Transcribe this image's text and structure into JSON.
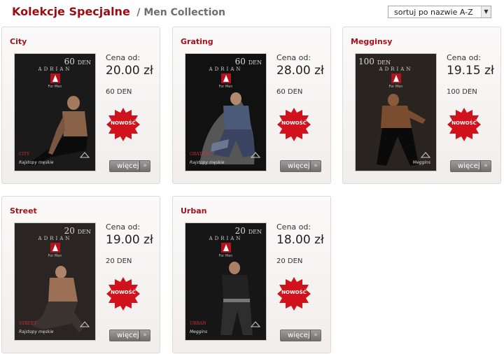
{
  "header": {
    "title": "Kolekcje Specjalne",
    "subtitle": "/ Men Collection",
    "sort_value": "sortuj po nazwie A-Z"
  },
  "colors": {
    "accent": "#a80f19",
    "badge": "#d0121c",
    "button": "#7f7f7f"
  },
  "products": [
    {
      "name": "City",
      "price_label": "Cena od:",
      "price": "20.00 zł",
      "den": "60 DEN",
      "pack_den": "60",
      "pack_den_unit": "DEN",
      "brand": "ADRIAN",
      "for_men": "For Men",
      "model": "CITY",
      "pack_caption": "Rajstopy męskie",
      "badge": "NOWOŚĆ",
      "more": "więcej"
    },
    {
      "name": "Grating",
      "price_label": "Cena od:",
      "price": "28.00 zł",
      "den": "60 DEN",
      "pack_den": "60",
      "pack_den_unit": "DEN",
      "brand": "ADRIAN",
      "for_men": "For Men",
      "model": "GRATING",
      "pack_caption": "Rajstopy męskie",
      "badge": "NOWOŚĆ",
      "more": "więcej"
    },
    {
      "name": "Megginsy",
      "price_label": "Cena od:",
      "price": "19.15 zł",
      "den": "100 DEN",
      "pack_den": "100",
      "pack_den_unit": "DEN",
      "brand": "ADRIAN",
      "for_men": "For Men",
      "model": "",
      "pack_caption": "Meggins",
      "badge": "NOWOŚĆ",
      "more": "więcej"
    },
    {
      "name": "Street",
      "price_label": "Cena od:",
      "price": "19.00 zł",
      "den": "20 DEN",
      "pack_den": "20",
      "pack_den_unit": "DEN",
      "brand": "ADRIAN",
      "for_men": "For Men",
      "model": "STREET",
      "pack_caption": "Rajstopy męskie",
      "badge": "NOWOŚĆ",
      "more": "więcej"
    },
    {
      "name": "Urban",
      "price_label": "Cena od:",
      "price": "18.00 zł",
      "den": "20 DEN",
      "pack_den": "20",
      "pack_den_unit": "DEN",
      "brand": "ADRIAN",
      "for_men": "For Men",
      "model": "URBAN",
      "pack_caption": "Meggins",
      "badge": "NOWOŚĆ",
      "more": "więcej"
    }
  ]
}
